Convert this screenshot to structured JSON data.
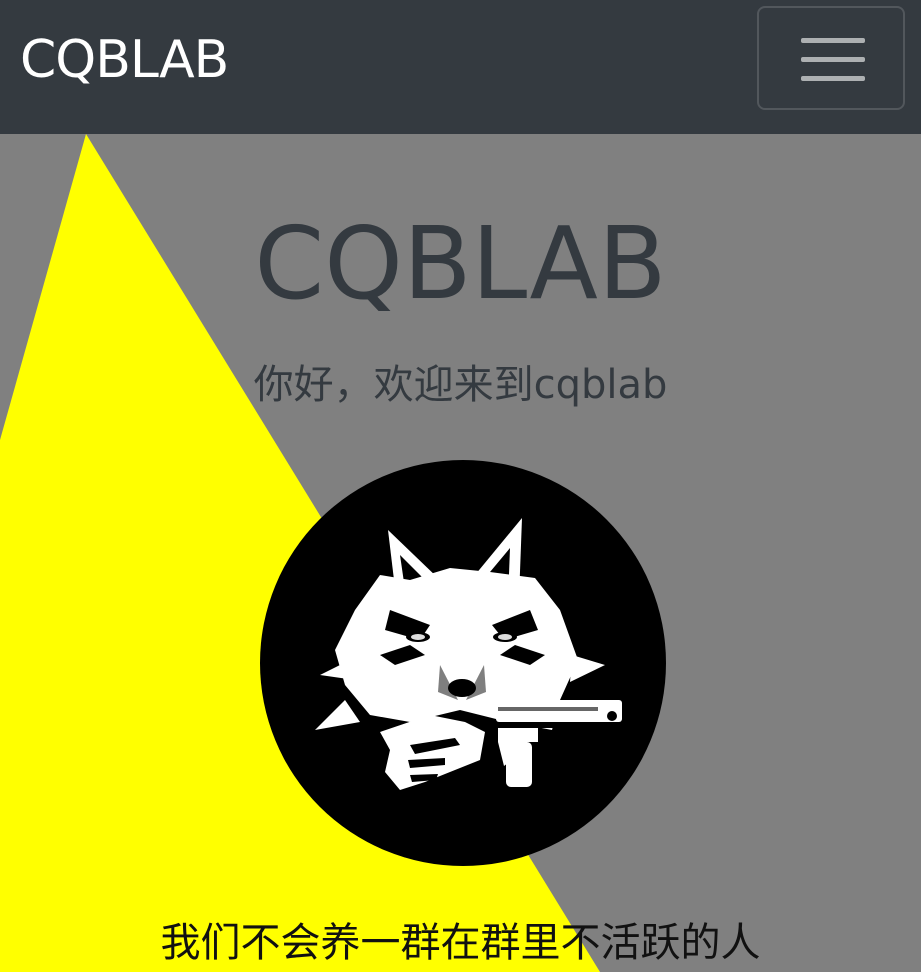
{
  "navbar": {
    "brand": "CQBLAB",
    "toggle_icon": "hamburger-menu-icon"
  },
  "hero": {
    "title": "CQBLAB",
    "subtitle": "你好，欢迎来到cqblab",
    "avatar_icon": "wolf-with-gun-logo",
    "tagline": "我们不会养一群在群里不活跃的人"
  },
  "colors": {
    "navbar_bg": "#343a40",
    "page_bg": "#808080",
    "accent_yellow": "#ffff00",
    "text_dark": "#343a40"
  }
}
